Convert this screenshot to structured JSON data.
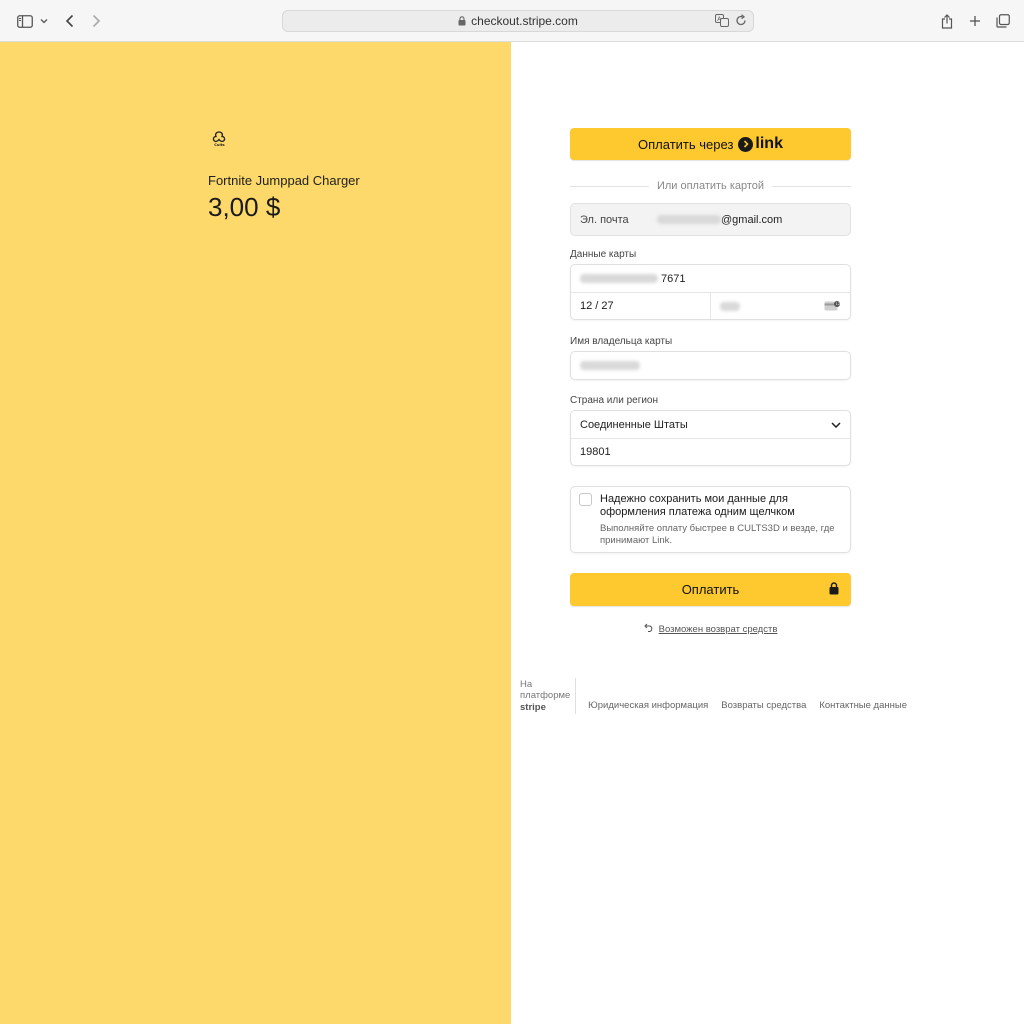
{
  "browser": {
    "url": "checkout.stripe.com"
  },
  "product": {
    "name": "Fortnite Jumppad Charger",
    "price": "3,00 $"
  },
  "form": {
    "link_button_prefix": "Оплатить через",
    "link_button_brand": "link",
    "divider_text": "Или оплатить картой",
    "email_label": "Эл. почта",
    "email_domain": "@gmail.com",
    "card_label": "Данные карты",
    "card_last4": "7671",
    "card_expiry": "12 / 27",
    "cardholder_label": "Имя владельца карты",
    "country_label": "Страна или регион",
    "country_value": "Соединенные Штаты",
    "zip_value": "19801",
    "save_title": "Надежно сохранить мои данные для оформления платежа одним щелчком",
    "save_desc": "Выполняйте оплату быстрее в CULTS3D и везде, где принимают Link.",
    "pay_label": "Оплатить",
    "refund_text": "Возможен возврат средств"
  },
  "footer": {
    "powered_line1": "На",
    "powered_line2": "платформе",
    "powered_brand": "stripe",
    "links": [
      "Юридическая информация",
      "Возвраты средства",
      "Контактные данные"
    ]
  },
  "colors": {
    "left_panel": "#fdd86a",
    "button": "#fdc92f"
  }
}
